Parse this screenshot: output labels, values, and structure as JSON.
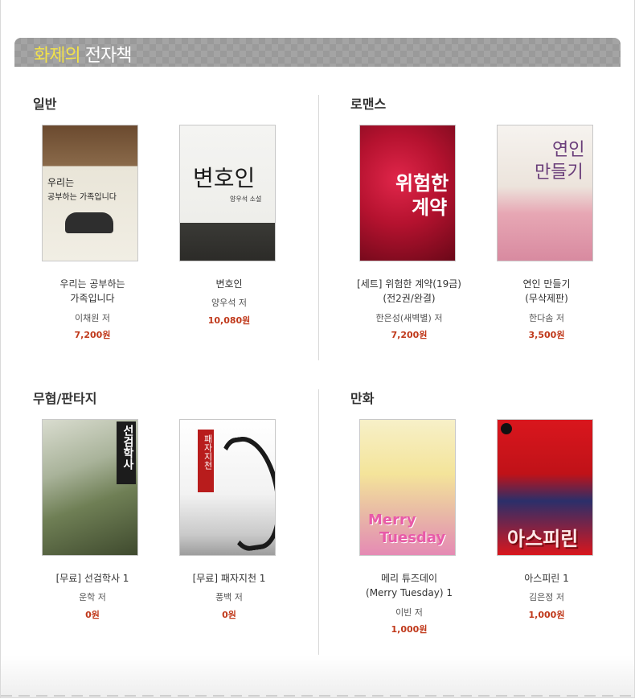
{
  "banner": {
    "title_highlight": "화제의",
    "title_rest": "전자책"
  },
  "sections": [
    {
      "name": "일반",
      "books": [
        {
          "title_line1": "우리는 공부하는",
          "title_line2": "가족입니다",
          "author": "이채원 저",
          "price": "7,200원",
          "cover_lines": [
            "우리는",
            "공부하는 가족입니다"
          ]
        },
        {
          "title_line1": "변호인",
          "title_line2": "",
          "author": "양우석 저",
          "price": "10,080원",
          "cover_lines": [
            "변호인",
            "양우석 소설"
          ]
        }
      ]
    },
    {
      "name": "로맨스",
      "books": [
        {
          "title_line1": "[세트] 위험한 계약(19금)",
          "title_line2": "(전2권/완결)",
          "author": "한은성(새벽별) 저",
          "price": "7,200원",
          "cover_lines": [
            "위험한",
            "계약"
          ]
        },
        {
          "title_line1": "연인 만들기",
          "title_line2": "(무삭제판)",
          "author": "한다솜 저",
          "price": "3,500원",
          "cover_lines": [
            "연인",
            "만들기"
          ]
        }
      ]
    },
    {
      "name": "무협/판타지",
      "books": [
        {
          "title_line1": "[무료] 선검학사 1",
          "title_line2": "",
          "author": "운학 저",
          "price": "0원",
          "cover_lines": [
            "선검학사"
          ]
        },
        {
          "title_line1": "[무료] 패자지천 1",
          "title_line2": "",
          "author": "풍백 저",
          "price": "0원",
          "cover_lines": [
            "패자지천"
          ]
        }
      ]
    },
    {
      "name": "만화",
      "books": [
        {
          "title_line1": "메리 튜즈데이",
          "title_line2": "(Merry Tuesday) 1",
          "author": "이빈 저",
          "price": "1,000원",
          "cover_lines": [
            "Merry",
            "Tuesday"
          ]
        },
        {
          "title_line1": "아스피린 1",
          "title_line2": "",
          "author": "김은정 저",
          "price": "1,000원",
          "cover_lines": [
            "아스피린"
          ]
        }
      ]
    }
  ],
  "colors": {
    "price": "#c0391b",
    "banner_highlight": "#f2e24a",
    "banner_bg": "#9a9a9a"
  }
}
